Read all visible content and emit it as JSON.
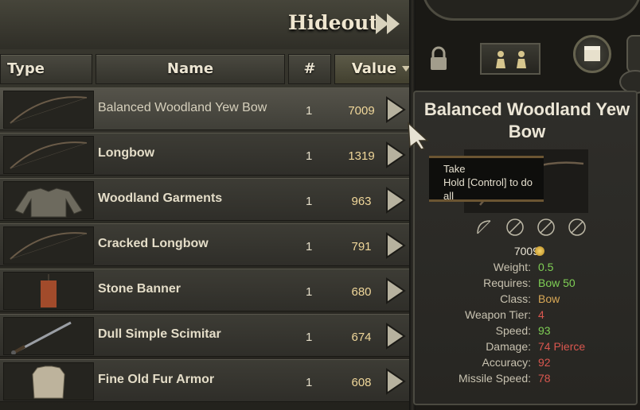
{
  "header": {
    "title": "Hideout"
  },
  "columns": {
    "type": "Type",
    "name": "Name",
    "count": "#",
    "value": "Value"
  },
  "items": [
    {
      "name": "Balanced Woodland Yew Bow",
      "count": "1",
      "value": "7009",
      "kind": "bow"
    },
    {
      "name": "Longbow",
      "count": "1",
      "value": "1319",
      "kind": "bow"
    },
    {
      "name": "Woodland Garments",
      "count": "1",
      "value": "963",
      "kind": "garment"
    },
    {
      "name": "Cracked Longbow",
      "count": "1",
      "value": "791",
      "kind": "bow"
    },
    {
      "name": "Stone Banner",
      "count": "1",
      "value": "680",
      "kind": "banner"
    },
    {
      "name": "Dull Simple Scimitar",
      "count": "1",
      "value": "674",
      "kind": "sword"
    },
    {
      "name": "Fine Old Fur Armor",
      "count": "1",
      "value": "608",
      "kind": "armor"
    }
  ],
  "tooltip": {
    "title": "Balanced Woodland Yew Bow",
    "hint_line1": "Take",
    "hint_line2": "Hold [Control] to do all",
    "price": "7009",
    "stats": [
      {
        "label": "Weight:",
        "value": "0.5",
        "color": "#7fcf55"
      },
      {
        "label": "Requires:",
        "value": "Bow 50",
        "color": "#7fcf55"
      },
      {
        "label": "Class:",
        "value": "Bow",
        "color": "#d9a856"
      },
      {
        "label": "Weapon Tier:",
        "value": "4",
        "color": "#d9574f"
      },
      {
        "label": "Speed:",
        "value": "93",
        "color": "#7fcf55"
      },
      {
        "label": "Damage:",
        "value": "74 Pierce",
        "color": "#d9574f"
      },
      {
        "label": "Accuracy:",
        "value": "92",
        "color": "#d9574f"
      },
      {
        "label": "Missile Speed:",
        "value": "78",
        "color": "#d9574f"
      }
    ]
  },
  "colors": {
    "gold": "#f0d79a",
    "good": "#7fcf55",
    "bad": "#d9574f",
    "neutral": "#d9a856"
  }
}
